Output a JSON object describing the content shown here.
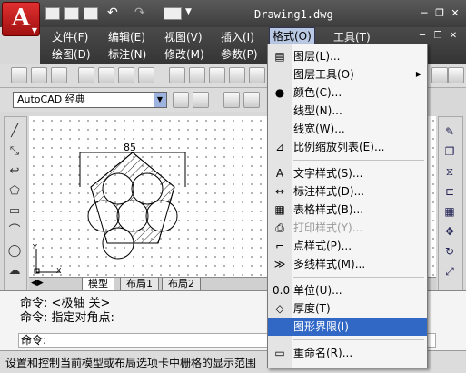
{
  "app": {
    "logo_letter": "A",
    "title": "Drawing1.dwg",
    "window_controls": [
      "─",
      "❐",
      "✕"
    ],
    "doc_controls": [
      "─",
      "❐",
      "✕"
    ]
  },
  "menubar": {
    "row1": [
      "文件(F)",
      "编辑(E)",
      "视图(V)",
      "插入(I)",
      "格式(O)",
      "工具(T)"
    ],
    "row2": [
      "绘图(D)",
      "标注(N)",
      "修改(M)",
      "参数(P)"
    ]
  },
  "workspace": {
    "selected": "AutoCAD 经典"
  },
  "format_menu": [
    {
      "icon": "layers-icon",
      "glyph": "▤",
      "label": "图层(L)..."
    },
    {
      "icon": "",
      "glyph": "",
      "label": "图层工具(O)",
      "submenu": true
    },
    {
      "icon": "color-wheel-icon",
      "glyph": "●",
      "label": "颜色(C)..."
    },
    {
      "icon": "",
      "glyph": "",
      "label": "线型(N)..."
    },
    {
      "icon": "",
      "glyph": "",
      "label": "线宽(W)..."
    },
    {
      "icon": "scale-list-icon",
      "glyph": "⊿",
      "label": "比例缩放列表(E)..."
    },
    {
      "sep": true
    },
    {
      "icon": "text-style-icon",
      "glyph": "A",
      "label": "文字样式(S)..."
    },
    {
      "icon": "dim-style-icon",
      "glyph": "↔",
      "label": "标注样式(D)..."
    },
    {
      "icon": "table-style-icon",
      "glyph": "▦",
      "label": "表格样式(B)..."
    },
    {
      "icon": "plot-style-icon",
      "glyph": "⎙",
      "label": "打印样式(Y)...",
      "disabled": true
    },
    {
      "icon": "point-style-icon",
      "glyph": "⌐",
      "label": "点样式(P)..."
    },
    {
      "icon": "mline-style-icon",
      "glyph": "≫",
      "label": "多线样式(M)..."
    },
    {
      "sep": true
    },
    {
      "icon": "units-icon",
      "glyph": "0.0",
      "label": "单位(U)..."
    },
    {
      "icon": "thickness-icon",
      "glyph": "◇",
      "label": "厚度(T)"
    },
    {
      "icon": "",
      "glyph": "",
      "label": "图形界限(I)",
      "highlighted": true
    },
    {
      "sep": true
    },
    {
      "icon": "rename-icon",
      "glyph": "▭",
      "label": "重命名(R)..."
    }
  ],
  "drawing": {
    "dimension": "85"
  },
  "ucs": {
    "x": "X",
    "y": "Y"
  },
  "tabs": [
    "模型",
    "布局1",
    "布局2"
  ],
  "command": {
    "line1": "命令: <极轴 关>",
    "line2": "命令: 指定对角点:",
    "prompt": "命令:"
  },
  "status": "设置和控制当前模型或布局选项卡中栅格的显示范围",
  "colors": {
    "highlight": "#3168c6",
    "titlebar": "#4a4a4a",
    "logo": "#c81e1e"
  }
}
